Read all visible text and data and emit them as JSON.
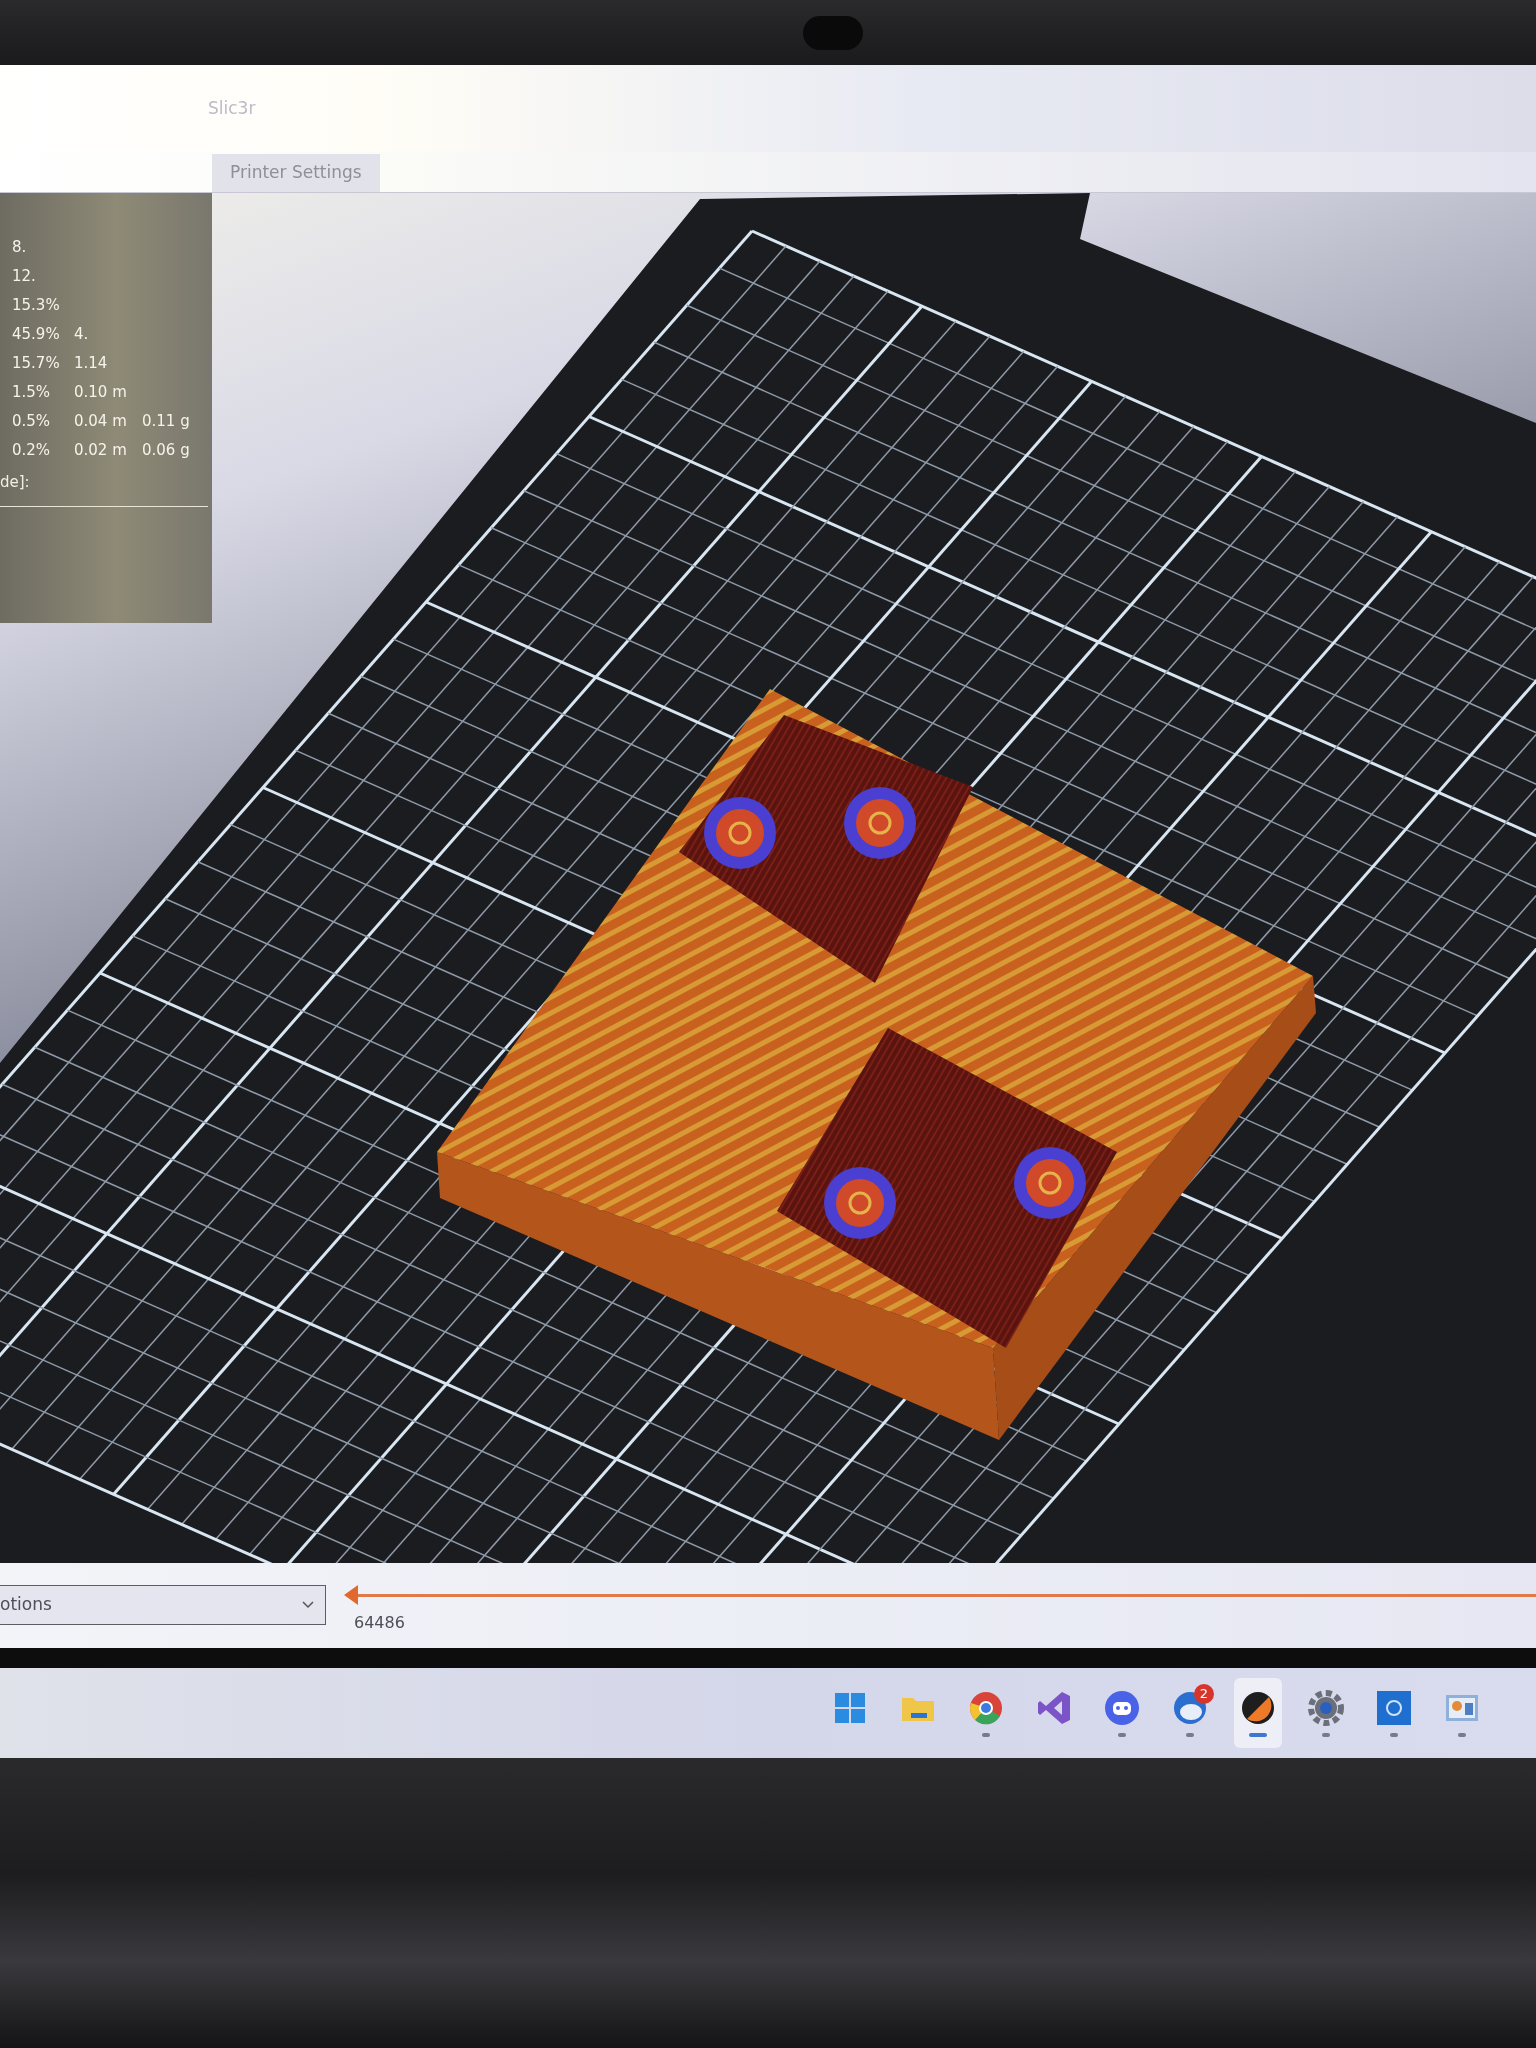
{
  "window": {
    "title": "Slic3r"
  },
  "tabs": [
    {
      "label": "Printer Settings"
    }
  ],
  "stats": {
    "rows": [
      {
        "cells": [
          "8."
        ]
      },
      {
        "cells": [
          "12."
        ]
      },
      {
        "cells": [
          "15.3%"
        ]
      },
      {
        "cells": [
          "45.9%",
          "4."
        ]
      },
      {
        "cells": [
          "15.7%",
          "1.14"
        ]
      },
      {
        "cells": [
          "1.5%",
          "0.10 m"
        ]
      },
      {
        "cells": [
          "0.5%",
          "0.04 m",
          "0.11 g"
        ]
      },
      {
        "cells": [
          "0.2%",
          "0.02 m",
          "0.06 g"
        ]
      }
    ],
    "footer": "de]:"
  },
  "bottom_bar": {
    "view_select": {
      "value": "otions"
    },
    "slider": {
      "level": 0,
      "value": "64486"
    }
  },
  "taskbar": {
    "apps": [
      {
        "kind": "start",
        "running": false,
        "selected": false
      },
      {
        "kind": "folder",
        "running": false,
        "selected": false
      },
      {
        "kind": "browser",
        "running": true,
        "selected": false
      },
      {
        "kind": "ide",
        "running": false,
        "selected": false
      },
      {
        "kind": "chat",
        "running": true,
        "selected": false
      },
      {
        "kind": "mail",
        "running": true,
        "selected": false,
        "badge": "2"
      },
      {
        "kind": "slicer",
        "running": true,
        "selected": true
      },
      {
        "kind": "gear",
        "running": true,
        "selected": false
      },
      {
        "kind": "tile",
        "running": true,
        "selected": false
      },
      {
        "kind": "chart",
        "running": true,
        "selected": false
      }
    ]
  }
}
